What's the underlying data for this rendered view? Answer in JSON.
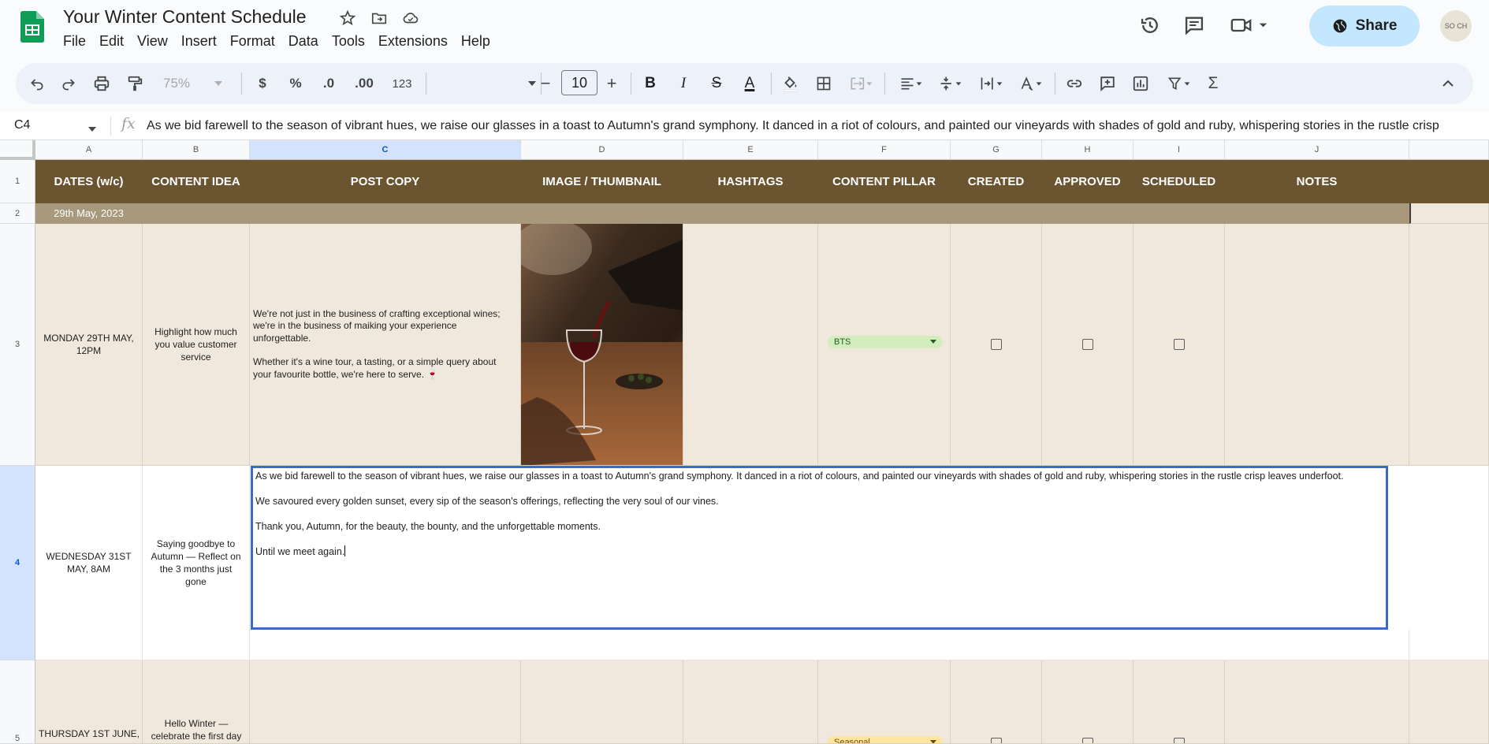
{
  "app": {
    "doc_title": "Your Winter Content Schedule",
    "menu": [
      "File",
      "Edit",
      "View",
      "Insert",
      "Format",
      "Data",
      "Tools",
      "Extensions",
      "Help"
    ],
    "share_label": "Share",
    "avatar_text": "SO CH"
  },
  "toolbar": {
    "zoom": "75%",
    "currency": "$",
    "percent": "%",
    "decrease_decimal": ".0",
    "increase_decimal": ".00",
    "number_format": "123",
    "font_size": "10",
    "minus": "−",
    "plus": "+",
    "bold": "B",
    "italic": "I",
    "strike": "S",
    "text_color": "A",
    "functions": "Σ"
  },
  "formula_bar": {
    "cell_ref": "C4",
    "fx_label": "fx",
    "content": "As we bid farewell to the season of vibrant hues, we raise our glasses in a toast to Autumn's grand symphony. It danced in a riot of colours, and painted our vineyards with shades of gold and ruby, whispering stories in the rustle crisp"
  },
  "columns": [
    {
      "letter": "A",
      "header": "DATES (w/c)"
    },
    {
      "letter": "B",
      "header": "CONTENT IDEA"
    },
    {
      "letter": "C",
      "header": "POST COPY"
    },
    {
      "letter": "D",
      "header": "IMAGE / THUMBNAIL"
    },
    {
      "letter": "E",
      "header": "HASHTAGS"
    },
    {
      "letter": "F",
      "header": "CONTENT PILLAR"
    },
    {
      "letter": "G",
      "header": "CREATED"
    },
    {
      "letter": "H",
      "header": "APPROVED"
    },
    {
      "letter": "I",
      "header": "SCHEDULED"
    },
    {
      "letter": "J",
      "header": "NOTES"
    }
  ],
  "row_numbers": [
    "1",
    "2",
    "3",
    "4",
    "5"
  ],
  "week_label": "29th May, 2023",
  "rows": [
    {
      "date": "MONDAY 29TH MAY, 12PM",
      "idea": "Highlight how much you value customer service",
      "copy_p1": "We're not just in the business of crafting exceptional wines; we're in the business of maiking your experience unforgettable.",
      "copy_p2": "Whether it's a wine tour, a tasting, or a simple query about your favourite bottle, we're here to serve. 🍷",
      "pillar": "BTS",
      "pillar_color": "#d4edbc"
    },
    {
      "date": "WEDNESDAY 31ST MAY, 8AM",
      "idea": "Saying goodbye to Autumn — Reflect on the 3 months just gone",
      "copy_lines": [
        "As we bid farewell to the season of vibrant hues, we raise our glasses in a toast to Autumn's grand symphony. It danced in a riot of colours, and painted our vineyards with shades of gold and ruby, whispering stories in the rustle crisp leaves underfoot.",
        "We savoured every golden sunset, every sip of the season's offerings, reflecting the very soul of our vines.",
        "Thank you, Autumn, for the beauty, the bounty, and the unforgettable moments.",
        "Until we meet again."
      ]
    },
    {
      "date": "THURSDAY 1ST JUNE,",
      "idea": "Hello Winter — celebrate the first day",
      "pillar": "Seasonal",
      "pillar_color": "#ffe5a0"
    }
  ],
  "colors": {
    "header_brown": "#6b5530",
    "week_band": "#a8997c",
    "row_beige": "#f0e8dc",
    "selection_blue": "#3c6cc0",
    "share_bg": "#c2e7ff"
  }
}
